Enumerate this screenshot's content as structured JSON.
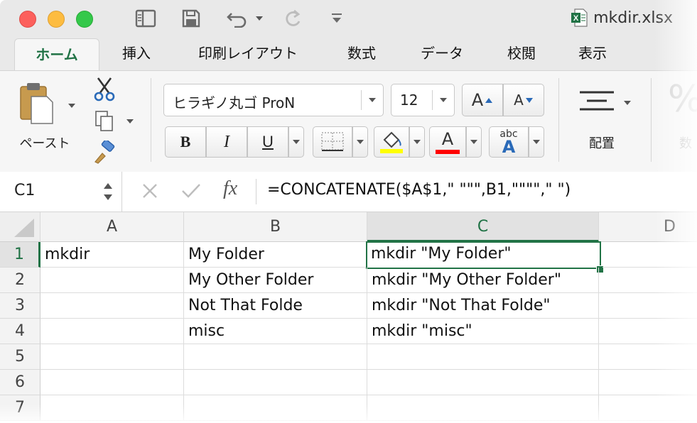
{
  "window": {
    "file_name": "mkdir.xlsx"
  },
  "ribbon_tabs": [
    "ホーム",
    "挿入",
    "印刷レイアウト",
    "数式",
    "データ",
    "校閲",
    "表示"
  ],
  "ribbon": {
    "paste_label": "ペースト",
    "font_name": "ヒラギノ丸ゴ ProN",
    "font_size": "12",
    "grow_font": "A",
    "shrink_font": "A",
    "bold": "B",
    "italic": "I",
    "underline": "U",
    "font_color_glyph": "A",
    "phonetic_top": "abc",
    "phonetic_bottom": "A",
    "align_label": "配置",
    "number_label": "数",
    "number_glyph": "%",
    "highlight_color": "#ffff00",
    "font_color": "#ff0000"
  },
  "formula_bar": {
    "name_box": "C1",
    "fx": "fx",
    "formula": "=CONCATENATE($A$1,\" \"\"\",B1,\"\"\"\",\" \")"
  },
  "columns": [
    "A",
    "B",
    "C",
    "D"
  ],
  "rows": [
    {
      "num": "1",
      "A": "mkdir",
      "B": "My Folder",
      "C": "mkdir \"My Folder\""
    },
    {
      "num": "2",
      "A": "",
      "B": "My Other Folder",
      "C": "mkdir \"My Other Folder\""
    },
    {
      "num": "3",
      "A": "",
      "B": "Not That Folde",
      "C": "mkdir \"Not That Folde\""
    },
    {
      "num": "4",
      "A": "",
      "B": "misc",
      "C": "mkdir \"misc\""
    },
    {
      "num": "5",
      "A": "",
      "B": "",
      "C": ""
    },
    {
      "num": "6",
      "A": "",
      "B": "",
      "C": ""
    },
    {
      "num": "7",
      "A": "",
      "B": "",
      "C": ""
    }
  ],
  "accent_color": "#217346"
}
